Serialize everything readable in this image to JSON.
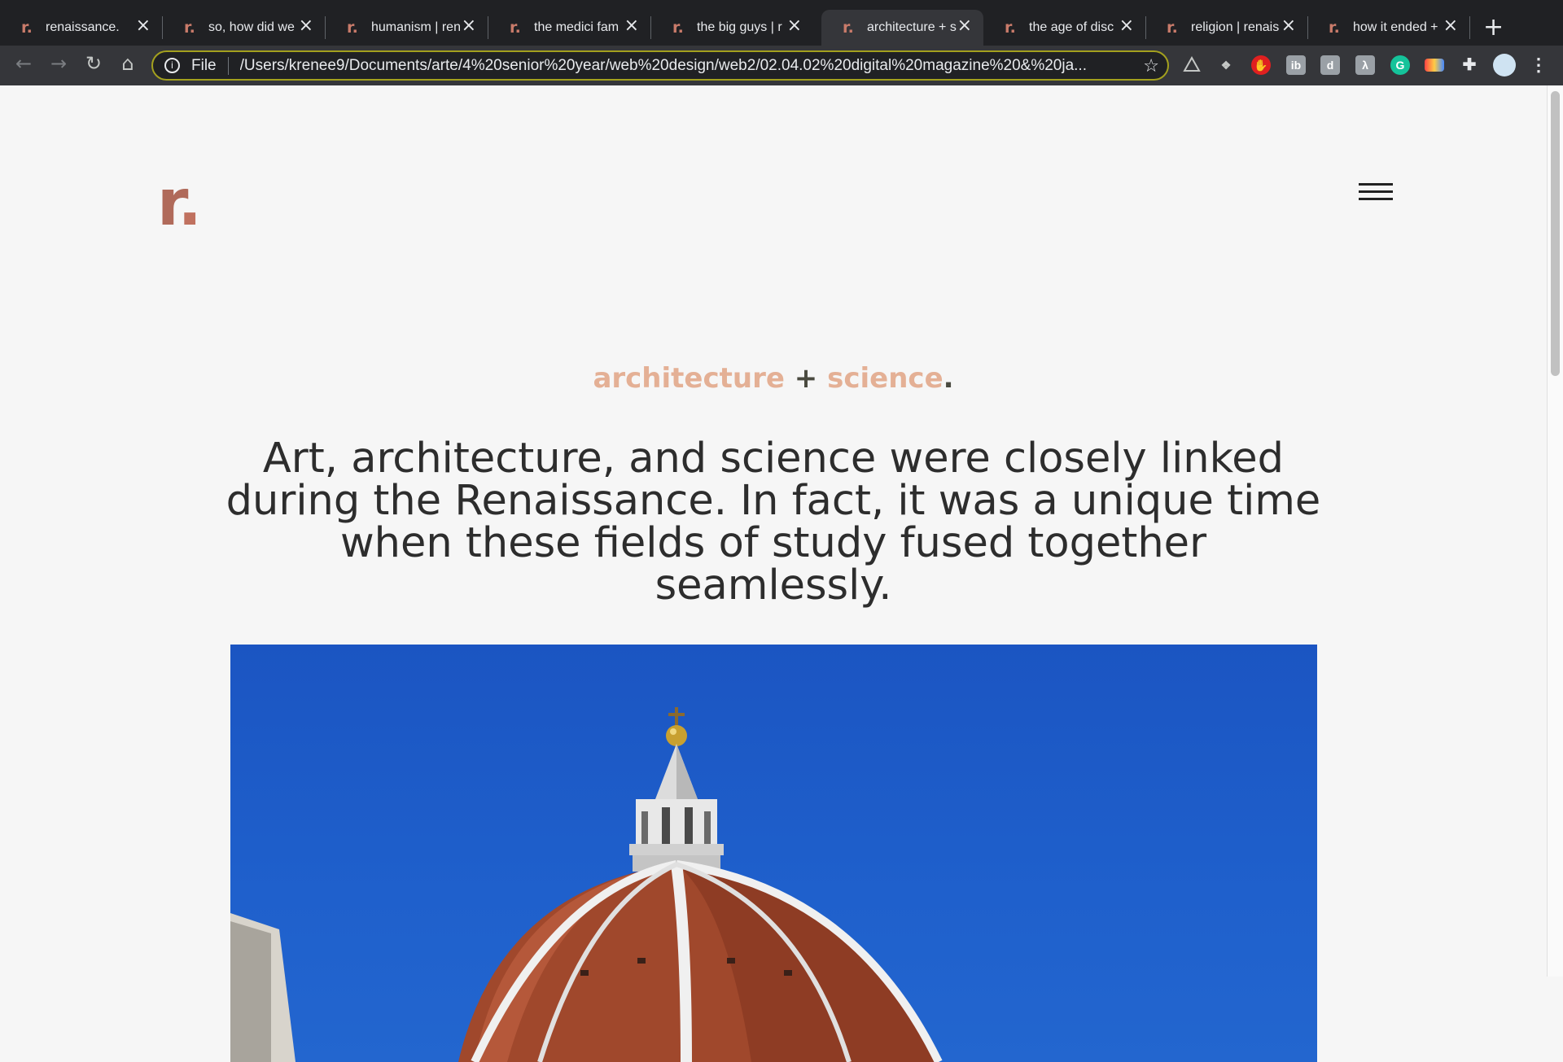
{
  "browser": {
    "tabs": [
      {
        "label": "renaissance.",
        "favicon": "r."
      },
      {
        "label": "so, how did we",
        "favicon": "r."
      },
      {
        "label": "humanism | ren",
        "favicon": "r."
      },
      {
        "label": "the medici fam",
        "favicon": "r."
      },
      {
        "label": "the big guys | r",
        "favicon": "r."
      },
      {
        "label": "architecture + s",
        "favicon": "r.",
        "active": true
      },
      {
        "label": "the age of disc",
        "favicon": "r."
      },
      {
        "label": "religion | renais",
        "favicon": "r."
      },
      {
        "label": "how it ended +",
        "favicon": "r."
      }
    ],
    "omnibox": {
      "scheme": "File",
      "url": "/Users/krenee9/Documents/arte/4%20senior%20year/web%20design/web2/02.04.02%20digital%20magazine%20&%20ja..."
    },
    "extensions": [
      "drive-icon",
      "dropbox-icon",
      "stop-icon",
      "ib-icon",
      "d-icon",
      "translate-icon",
      "grammarly-icon",
      "palette-icon",
      "puzzle-icon",
      "profile-avatar"
    ]
  },
  "site": {
    "logo": {
      "letter": "r",
      "dot": "."
    },
    "section_title": {
      "word1": "architecture",
      "plus": "+",
      "word2": "science",
      "period": "."
    },
    "lede": "Art, architecture, and science were closely linked during the Renaissance. In fact, it was a unique time when these fields of study fused together seamlessly."
  },
  "colors": {
    "accent": "#b06a5a",
    "title_peach": "#e4b095",
    "sky_blue": "#1b55c2"
  }
}
